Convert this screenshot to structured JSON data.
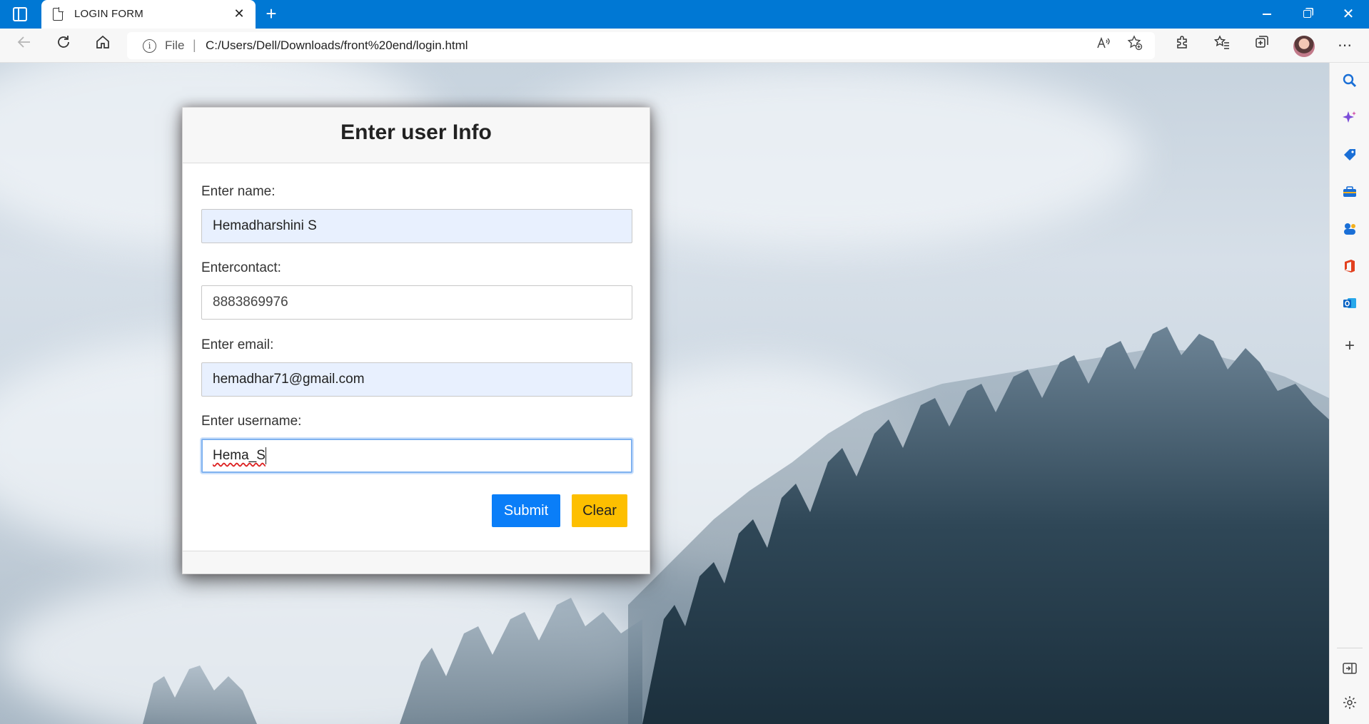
{
  "browser": {
    "tab_title": "LOGIN FORM",
    "tab_close": "✕",
    "new_tab": "+",
    "address_scheme": "File",
    "address_url": "C:/Users/Dell/Downloads/front%20end/login.html"
  },
  "form": {
    "title": "Enter user Info",
    "fields": [
      {
        "label": "Enter name:",
        "value": "Hemadharshini S"
      },
      {
        "label": "Entercontact:",
        "value": "8883869976"
      },
      {
        "label": "Enter email:",
        "value": "hemadhar71@gmail.com"
      },
      {
        "label": "Enter username:",
        "value": "Hema_S"
      }
    ],
    "submit_label": "Submit",
    "clear_label": "Clear"
  },
  "colors": {
    "titlebar": "#0078d4",
    "submit": "#0a7ef8",
    "clear": "#fdbf00",
    "autofill": "#e8f0fe"
  },
  "icons": {
    "toolbar": [
      "back-icon",
      "refresh-icon",
      "home-icon",
      "read-aloud-icon",
      "favorite-add-icon",
      "extensions-icon",
      "favorites-icon",
      "collections-icon",
      "profile-avatar",
      "more-icon"
    ],
    "sidebar": [
      "search-icon",
      "copilot-icon",
      "shopping-icon",
      "tools-icon",
      "games-icon",
      "office-icon",
      "outlook-icon",
      "add-icon",
      "hide-sidebar-icon",
      "settings-icon"
    ]
  }
}
